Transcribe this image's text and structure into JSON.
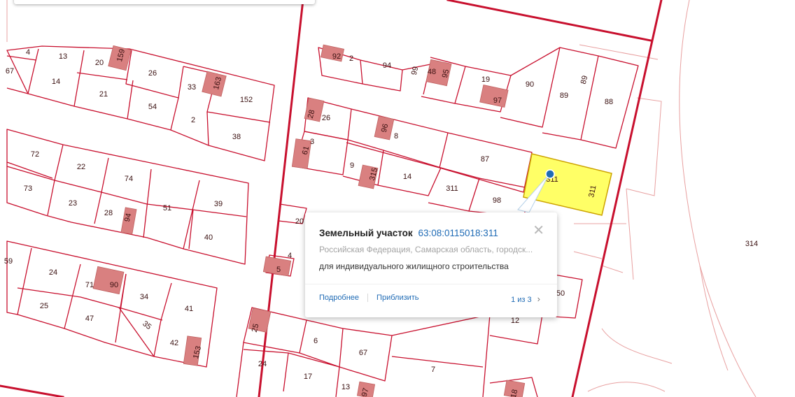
{
  "map": {
    "colors": {
      "boundary": "#c8102e",
      "building": "#d98080",
      "selected_fill": "#ffff66",
      "selected_stroke": "#cca200",
      "thin_line": "#e8a0a0",
      "marker": "#1f6bb5"
    },
    "parcel_labels": [
      "4",
      "13",
      "20",
      "159",
      "67",
      "14",
      "26",
      "33",
      "163",
      "21",
      "152",
      "54",
      "2",
      "38",
      "72",
      "22",
      "74",
      "73",
      "23",
      "28",
      "94",
      "51",
      "39",
      "40",
      "59",
      "24",
      "71",
      "90",
      "34",
      "41",
      "25",
      "47",
      "35",
      "42",
      "153",
      "92",
      "2",
      "94",
      "99",
      "48",
      "95",
      "19",
      "97",
      "90",
      "89",
      "89",
      "88",
      "26",
      "28",
      "96",
      "8",
      "3",
      "61",
      "9",
      "315",
      "14",
      "87",
      "311",
      "311",
      "98",
      "20",
      "4",
      "5",
      "50",
      "12",
      "25",
      "6",
      "67",
      "24",
      "17",
      "7",
      "13",
      "97",
      "18",
      "314",
      "59",
      "6"
    ],
    "selected_parcel_label": "311"
  },
  "popup": {
    "title": "Земельный участок",
    "cadastral_number": "63:08:0115018:311",
    "address": "Российская Федерация, Самарская область, городск...",
    "purpose": "для индивидуального жилищного строительства",
    "details_link": "Подробнее",
    "zoom_link": "Приблизить",
    "pager": "1 из 3",
    "close_icon": "close-icon",
    "next_icon": "chevron-right-icon"
  }
}
